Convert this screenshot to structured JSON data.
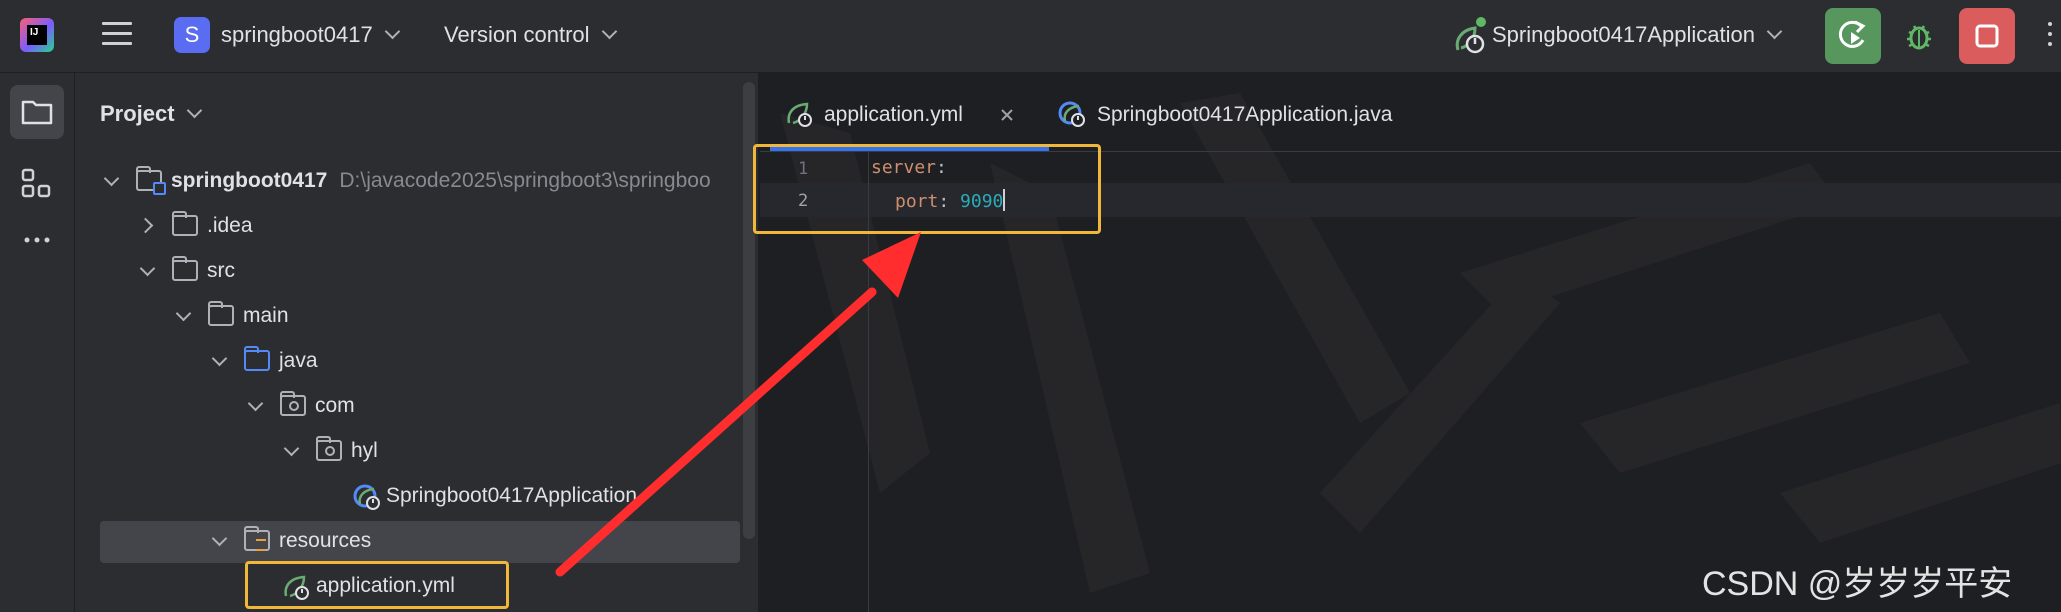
{
  "topbar": {
    "project_badge": "S",
    "project_name": "springboot0417",
    "version_control": "Version control",
    "run_config": "Springboot0417Application"
  },
  "sidebar": {
    "tools": [
      "folder-icon",
      "structure-icon",
      "more-horizontal-icon"
    ]
  },
  "project_panel": {
    "title": "Project",
    "tree": [
      {
        "label": "springboot0417",
        "path": "D:\\javacode2025\\springboot3\\springboo",
        "depth": 0,
        "expanded": true,
        "icon": "module-folder-icon"
      },
      {
        "label": ".idea",
        "depth": 1,
        "expanded": false,
        "icon": "folder-icon"
      },
      {
        "label": "src",
        "depth": 1,
        "expanded": true,
        "icon": "folder-icon"
      },
      {
        "label": "main",
        "depth": 2,
        "expanded": true,
        "icon": "folder-icon"
      },
      {
        "label": "java",
        "depth": 3,
        "expanded": true,
        "icon": "source-folder-icon"
      },
      {
        "label": "com",
        "depth": 4,
        "expanded": true,
        "icon": "package-icon"
      },
      {
        "label": "hyl",
        "depth": 5,
        "expanded": true,
        "icon": "package-icon"
      },
      {
        "label": "Springboot0417Application",
        "depth": 6,
        "icon": "spring-boot-class-icon"
      },
      {
        "label": "resources",
        "depth": 3,
        "expanded": true,
        "icon": "resources-folder-icon",
        "selected": true
      },
      {
        "label": "application.yml",
        "depth": 4,
        "icon": "spring-yml-icon"
      }
    ]
  },
  "editor": {
    "tabs": [
      {
        "label": "application.yml",
        "active": true,
        "closable": true
      },
      {
        "label": "Springboot0417Application.java",
        "active": false
      }
    ],
    "lines": [
      {
        "number": "1",
        "key": "server",
        "value": ""
      },
      {
        "number": "2",
        "key": "port",
        "value": "9090"
      }
    ]
  },
  "watermark": "CSDN @岁岁岁平安",
  "colors": {
    "accent": "#3574f0",
    "highlight_box": "#f0b73a",
    "arrow": "#ff2d2d",
    "run_button": "#57965c",
    "stop_button": "#db5c5c"
  }
}
